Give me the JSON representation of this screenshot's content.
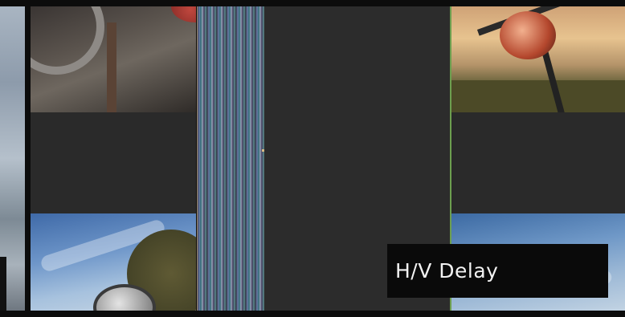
{
  "overlay": {
    "label": "H/V Delay"
  },
  "colors": {
    "divider": "#6d9f4f",
    "panel_dark": "#2c2c2c",
    "label_bg": "#0a0a0a",
    "label_text": "#f2f2f2"
  }
}
